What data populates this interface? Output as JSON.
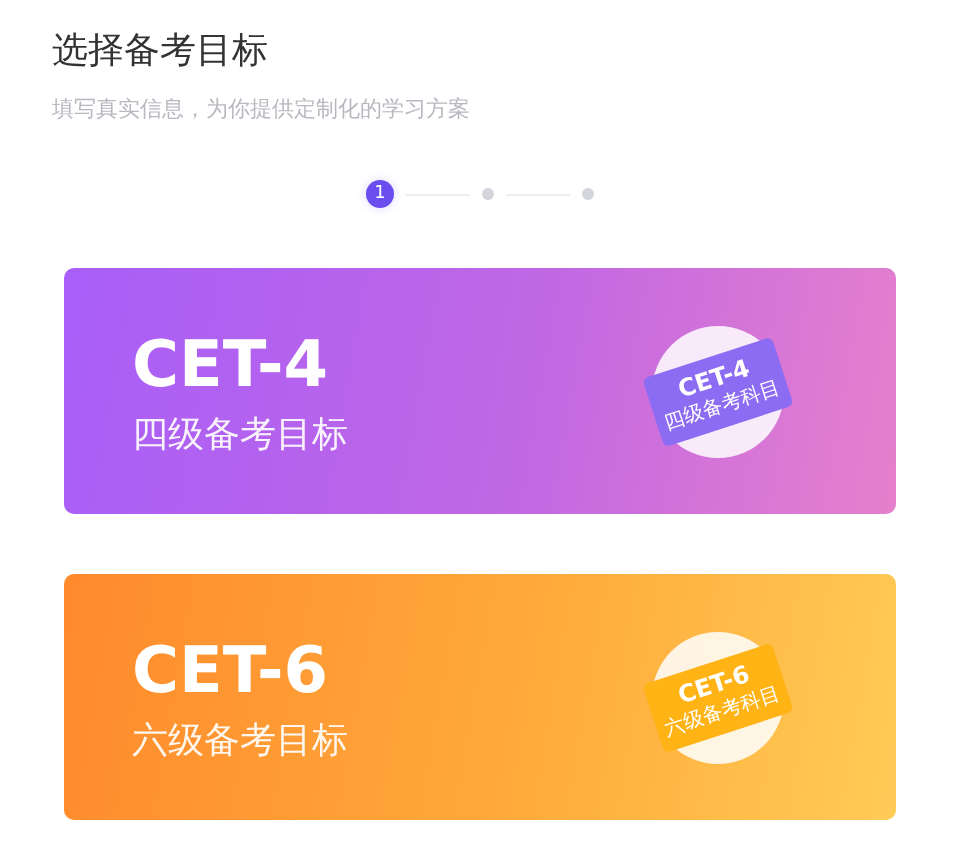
{
  "title": "选择备考目标",
  "subtitle": "填写真实信息，为你提供定制化的学习方案",
  "steps": [
    {
      "label": "1",
      "selected": true
    },
    {
      "selected": false
    },
    {
      "selected": false
    }
  ],
  "cards": [
    {
      "kind": "cet4",
      "title": "CET-4",
      "subtitle": "四级备考目标",
      "book_title": "CET-4",
      "book_subtitle": "四级备考科目"
    },
    {
      "kind": "cet6",
      "title": "CET-6",
      "subtitle": "六级备考目标",
      "book_title": "CET-6",
      "book_subtitle": "六级备考科目"
    }
  ]
}
